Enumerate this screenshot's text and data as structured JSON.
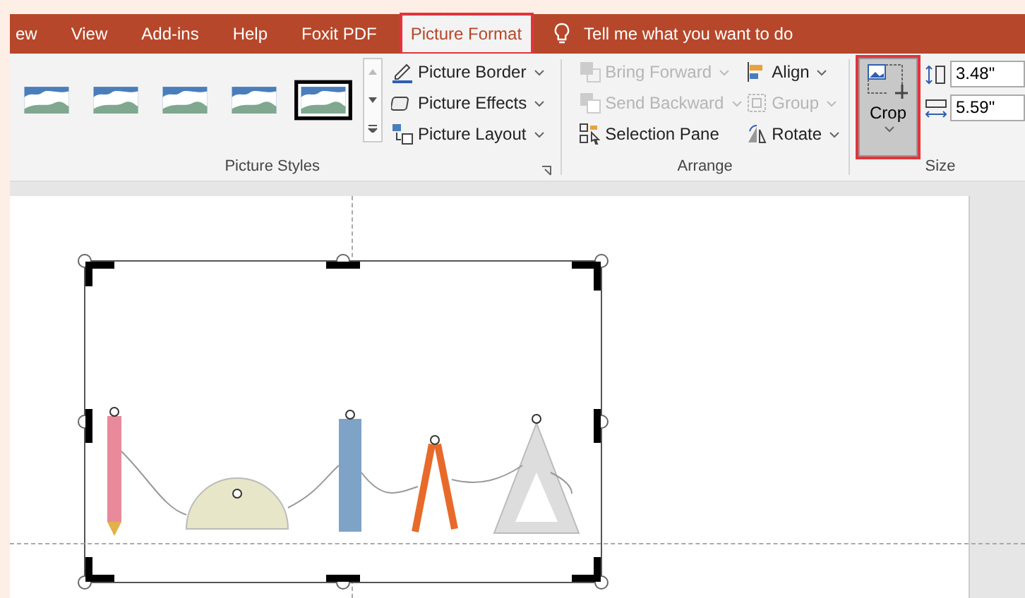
{
  "tabs": [
    {
      "label": "ew",
      "selected": false
    },
    {
      "label": "View",
      "selected": false
    },
    {
      "label": "Add-ins",
      "selected": false
    },
    {
      "label": "Help",
      "selected": false
    },
    {
      "label": "Foxit PDF",
      "selected": false
    },
    {
      "label": "Picture Format",
      "selected": true
    }
  ],
  "tell_me": {
    "placeholder": "Tell me what you want to do"
  },
  "picture_styles": {
    "label": "Picture Styles",
    "styles": [
      {
        "selected": false
      },
      {
        "selected": false
      },
      {
        "selected": false
      },
      {
        "selected": false
      },
      {
        "selected": true
      }
    ],
    "commands": [
      {
        "kind": "border",
        "label": "Picture Border"
      },
      {
        "kind": "effects",
        "label": "Picture Effects"
      },
      {
        "kind": "layout",
        "label": "Picture Layout"
      }
    ]
  },
  "arrange": {
    "label": "Arrange",
    "items": [
      {
        "kind": "forward",
        "label": "Bring Forward",
        "disabled": true,
        "dropdown": true
      },
      {
        "kind": "align",
        "label": "Align",
        "disabled": false,
        "dropdown": true
      },
      {
        "kind": "backward",
        "label": "Send Backward",
        "disabled": true,
        "dropdown": true
      },
      {
        "kind": "group",
        "label": "Group",
        "disabled": true,
        "dropdown": true
      },
      {
        "kind": "pane",
        "label": "Selection Pane",
        "disabled": false,
        "dropdown": false
      },
      {
        "kind": "rotate",
        "label": "Rotate",
        "disabled": false,
        "dropdown": true
      }
    ]
  },
  "size": {
    "label": "Size",
    "crop": {
      "label": "Crop",
      "selected": true
    },
    "height": "3.48\"",
    "width": "5.59\""
  }
}
